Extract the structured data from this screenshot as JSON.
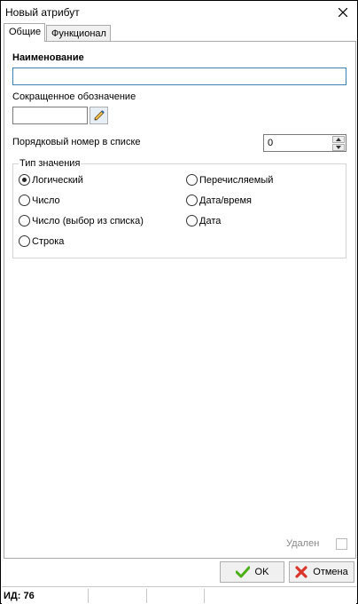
{
  "window": {
    "title": "Новый атрибут"
  },
  "tabs": [
    {
      "label": "Общие",
      "active": true
    },
    {
      "label": "Функционал",
      "active": false
    }
  ],
  "form": {
    "name_label": "Наименование",
    "name_value": "",
    "abbr_label": "Сокращенное обозначение",
    "abbr_value": "",
    "order_label": "Порядковый номер в списке",
    "order_value": "0"
  },
  "value_type": {
    "caption": "Тип значения",
    "options": [
      {
        "label": "Логический",
        "checked": true
      },
      {
        "label": "Число",
        "checked": false
      },
      {
        "label": "Число (выбор из списка)",
        "checked": false
      },
      {
        "label": "Строка",
        "checked": false
      },
      {
        "label": "Перечисляемый",
        "checked": false
      },
      {
        "label": "Дата/время",
        "checked": false
      },
      {
        "label": "Дата",
        "checked": false
      }
    ]
  },
  "deleted": {
    "label": "Удален",
    "checked": false
  },
  "buttons": {
    "ok": "OK",
    "cancel": "Отмена"
  },
  "status": {
    "id_text": "ИД: 76"
  },
  "colors": {
    "focus_border": "#3c7fb1",
    "ok_check": "#4caf1a",
    "cancel_x": "#d9362b"
  }
}
